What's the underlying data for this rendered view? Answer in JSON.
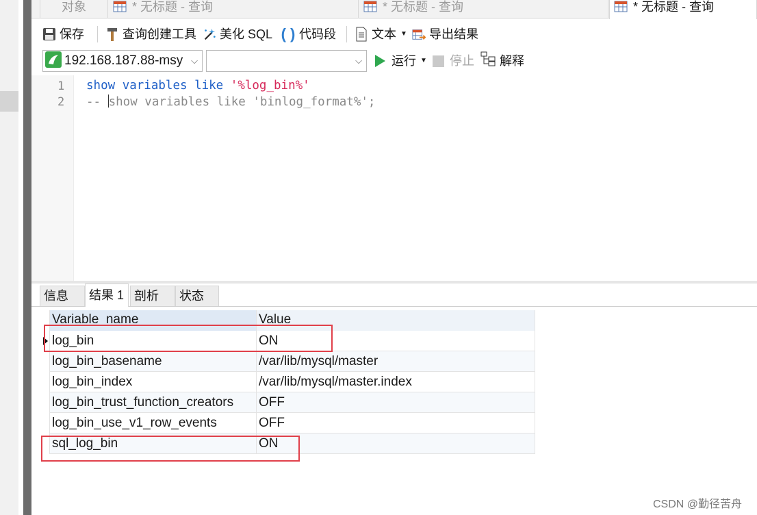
{
  "tabs": [
    {
      "label": "对象"
    },
    {
      "label": "* 无标题 - 查询"
    },
    {
      "label": "* 无标题 - 查询"
    },
    {
      "label": "* 无标题 - 查询"
    }
  ],
  "toolbar": {
    "save": "保存",
    "query_builder": "查询创建工具",
    "beautify": "美化 SQL",
    "snippet": "代码段",
    "text": "文本",
    "export": "导出结果"
  },
  "connection": {
    "host": "192.168.187.88-msy",
    "database": ""
  },
  "actions": {
    "run": "运行",
    "stop": "停止",
    "explain": "解释"
  },
  "editor": {
    "line_numbers": [
      "1",
      "2"
    ],
    "line1": {
      "kw1": "show",
      "kw2": "variables",
      "kw3": "like",
      "str": "'%log_bin%'"
    },
    "line2": {
      "comment_prefix": "-- ",
      "comment_rest": "show variables like 'binlog_format%';"
    }
  },
  "result_tabs": [
    {
      "label": "信息"
    },
    {
      "label": "结果 1"
    },
    {
      "label": "剖析"
    },
    {
      "label": "状态"
    }
  ],
  "grid": {
    "columns": [
      "Variable_name",
      "Value"
    ],
    "rows": [
      [
        "log_bin",
        "ON"
      ],
      [
        "log_bin_basename",
        "/var/lib/mysql/master"
      ],
      [
        "log_bin_index",
        "/var/lib/mysql/master.index"
      ],
      [
        "log_bin_trust_function_creators",
        "OFF"
      ],
      [
        "log_bin_use_v1_row_events",
        "OFF"
      ],
      [
        "sql_log_bin",
        "ON"
      ]
    ]
  },
  "watermark": "CSDN @勤径苦舟",
  "colors": {
    "keyword": "#1e5fc7",
    "string": "#d6295a",
    "comment": "#8a8a8a",
    "highlight": "#e0404a",
    "run_green": "#2fa84f"
  }
}
